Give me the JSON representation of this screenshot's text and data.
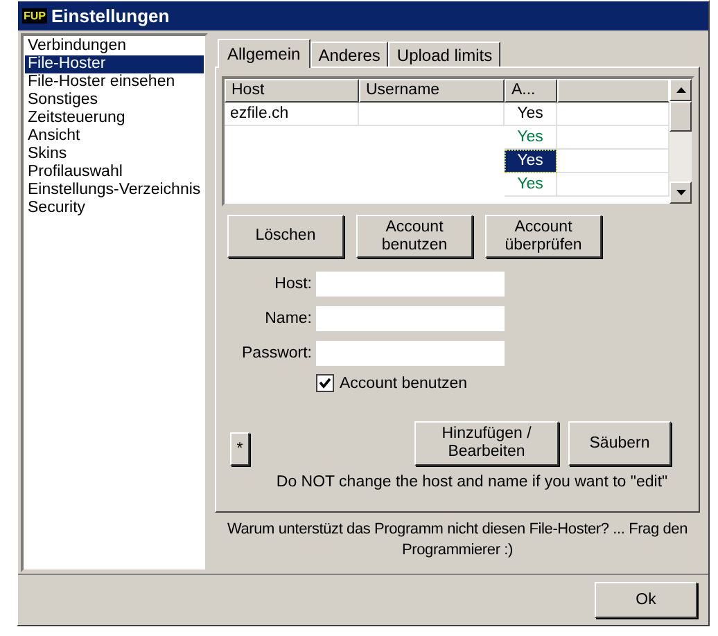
{
  "window": {
    "logo": "FUP",
    "title": "Einstellungen"
  },
  "sidebar": {
    "items": [
      {
        "label": "Verbindungen",
        "selected": false
      },
      {
        "label": "File-Hoster",
        "selected": true
      },
      {
        "label": "File-Hoster einsehen",
        "selected": false
      },
      {
        "label": "Sonstiges",
        "selected": false
      },
      {
        "label": "Zeitsteuerung",
        "selected": false
      },
      {
        "label": "Ansicht",
        "selected": false
      },
      {
        "label": "Skins",
        "selected": false
      },
      {
        "label": "Profilauswahl",
        "selected": false
      },
      {
        "label": "Einstellungs-Verzeichnis",
        "selected": false
      },
      {
        "label": "Security",
        "selected": false
      }
    ]
  },
  "tabs": [
    {
      "label": "Allgemein",
      "selected": true
    },
    {
      "label": "Anderes",
      "selected": false
    },
    {
      "label": "Upload limits",
      "selected": false
    }
  ],
  "table": {
    "columns": [
      "Host",
      "Username",
      "A..."
    ],
    "rows": [
      {
        "host": "ezfile.ch",
        "account": "Yes",
        "color": "#000000",
        "selected": false
      },
      {
        "account": "Yes",
        "color": "#008040",
        "selected": false
      },
      {
        "account": "Yes",
        "selected": true
      },
      {
        "account": "Yes",
        "color": "#008040",
        "selected": false
      }
    ]
  },
  "actions": [
    "Löschen",
    "Account benutzen",
    "Account überprüfen"
  ],
  "form": {
    "fields": [
      {
        "label": "Host:"
      },
      {
        "label": "Name:"
      },
      {
        "label": "Passwort:"
      }
    ],
    "checkbox": {
      "label": "Account benutzen",
      "checked": true
    }
  },
  "star_button": "*",
  "edit_buttons": [
    "Hinzufügen / Bearbeiten",
    "Säubern"
  ],
  "note": "Do NOT change the host and name if you want to \"edit\"",
  "footer_text": "Warum unterstüzt das Programm nicht diesen File-Hoster? ... Frag den Programmierer :)",
  "ok_button": "Ok"
}
